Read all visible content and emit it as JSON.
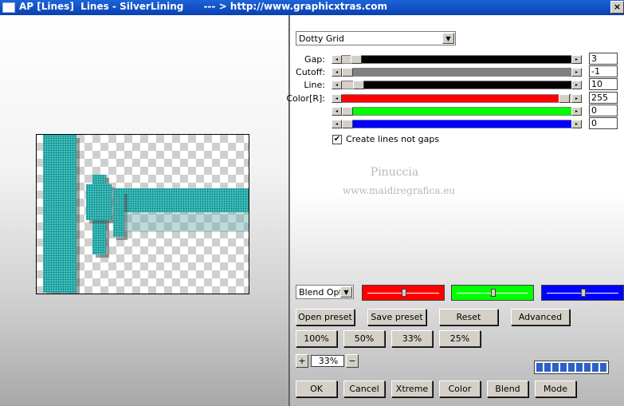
{
  "window": {
    "title": "AP [Lines]  Lines - SilverLining      --- > http://www.graphicxtras.com",
    "close_label": "×"
  },
  "effect": {
    "selected": "Dotty Grid"
  },
  "sliders": [
    {
      "label": "Gap:",
      "value": "3",
      "color": "#000000",
      "fraction": 0.04
    },
    {
      "label": "Cutoff:",
      "value": "-1",
      "color": "#808080",
      "fraction": 0.0
    },
    {
      "label": "Line:",
      "value": "10",
      "color": "#000000",
      "fraction": 0.05
    },
    {
      "label": "Color[R]:",
      "value": "255",
      "color": "#ff0000",
      "fraction": 1.0
    },
    {
      "label": "",
      "value": "0",
      "color": "#00ff00",
      "fraction": 0.0
    },
    {
      "label": "",
      "value": "0",
      "color": "#0000ff",
      "fraction": 0.0
    }
  ],
  "checkbox": {
    "label": "Create lines not gaps",
    "checked": true,
    "mark": "✔"
  },
  "watermark": {
    "line1": "Pinuccia",
    "line2": "www.maidiregrafica.eu"
  },
  "blend": {
    "selected": "Blend Optio"
  },
  "blend_colors": [
    {
      "color": "#ff0000",
      "knob": 0.5
    },
    {
      "color": "#00ff00",
      "knob": 0.5
    },
    {
      "color": "#0000ff",
      "knob": 0.5
    }
  ],
  "preset_buttons": {
    "open": "Open preset",
    "save": "Save preset",
    "reset": "Reset",
    "advanced": "Advanced"
  },
  "zoom_buttons": [
    "100%",
    "50%",
    "33%",
    "25%"
  ],
  "zoom": {
    "plus": "+",
    "value": "33%",
    "minus": "−"
  },
  "progress": {
    "segments": 9
  },
  "bottom_buttons": {
    "ok": "OK",
    "cancel": "Cancel",
    "xtreme": "Xtreme",
    "color": "Color",
    "blend": "Blend",
    "mode": "Mode"
  }
}
